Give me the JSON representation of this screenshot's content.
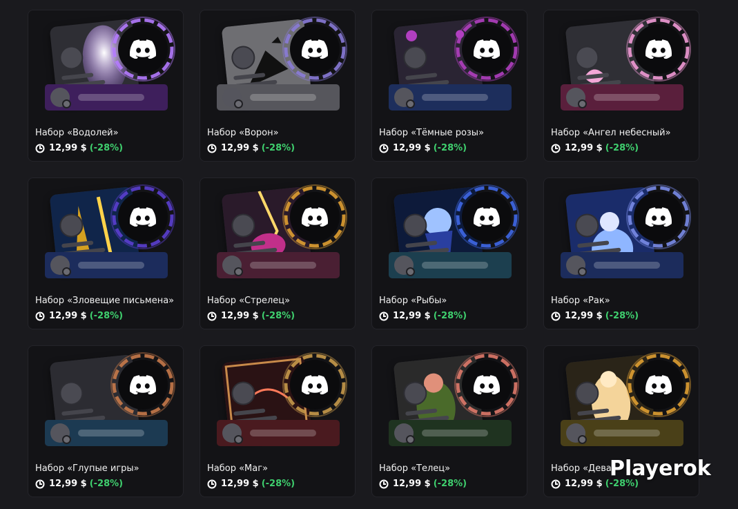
{
  "products": [
    {
      "title": "Набор «Водолей»",
      "price": "12,99 $",
      "discount": "(-28%)",
      "bar_color": "#3e1f5c",
      "accent": "#b57bff",
      "icon": "aquarius-art-icon"
    },
    {
      "title": "Набор «Ворон»",
      "price": "12,99 $",
      "discount": "(-28%)",
      "bar_color": "#56565c",
      "accent": "#8a7bd8",
      "icon": "raven-art-icon"
    },
    {
      "title": "Набор «Тёмные розы»",
      "price": "12,99 $",
      "discount": "(-28%)",
      "bar_color": "#1d2e5c",
      "accent": "#b13fc0",
      "icon": "dark-roses-art-icon"
    },
    {
      "title": "Набор «Ангел небесный»",
      "price": "12,99 $",
      "discount": "(-28%)",
      "bar_color": "#5a1f3c",
      "accent": "#f29bd6",
      "icon": "angel-art-icon"
    },
    {
      "title": "Набор «Зловещие письмена»",
      "price": "12,99 $",
      "discount": "(-28%)",
      "bar_color": "#1c2c5c",
      "accent": "#5b3fd0",
      "icon": "ominous-runes-art-icon"
    },
    {
      "title": "Набор «Стрелец»",
      "price": "12,99 $",
      "discount": "(-28%)",
      "bar_color": "#4a1f33",
      "accent": "#e0a032",
      "icon": "sagittarius-art-icon"
    },
    {
      "title": "Набор «Рыбы»",
      "price": "12,99 $",
      "discount": "(-28%)",
      "bar_color": "#1c3f4f",
      "accent": "#3f68e8",
      "icon": "pisces-art-icon"
    },
    {
      "title": "Набор «Рак»",
      "price": "12,99 $",
      "discount": "(-28%)",
      "bar_color": "#1c2c5c",
      "accent": "#7a8ce8",
      "icon": "cancer-art-icon"
    },
    {
      "title": "Набор «Глупые игры»",
      "price": "12,99 $",
      "discount": "(-28%)",
      "bar_color": "#1c3a52",
      "accent": "#c87a4a",
      "icon": "silly-games-art-icon"
    },
    {
      "title": "Набор «Маг»",
      "price": "12,99 $",
      "discount": "(-28%)",
      "bar_color": "#4a1a1f",
      "accent": "#c89a4a",
      "icon": "mage-art-icon"
    },
    {
      "title": "Набор «Телец»",
      "price": "12,99 $",
      "discount": "(-28%)",
      "bar_color": "#1f3320",
      "accent": "#e07a6a",
      "icon": "taurus-art-icon"
    },
    {
      "title": "Набор «Дева»",
      "price": "12,99 $",
      "discount": "(-28%)",
      "bar_color": "#4a4018",
      "accent": "#e0a032",
      "icon": "virgo-art-icon"
    }
  ],
  "watermark": "Playerok",
  "colors": {
    "background": "#1a1a1e",
    "card": "#131316",
    "discount": "#3fcf6e"
  }
}
